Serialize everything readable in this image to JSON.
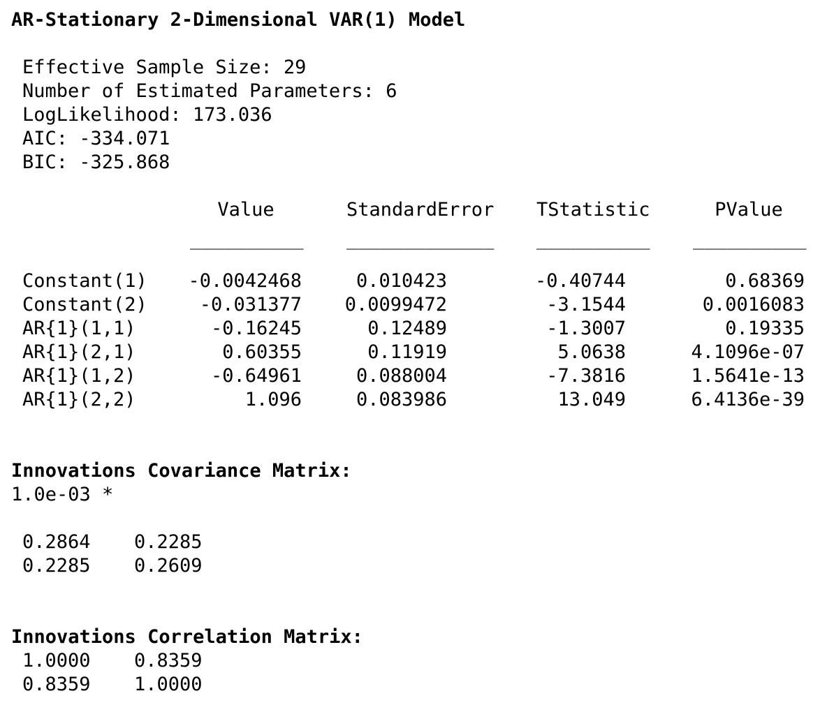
{
  "title": "AR-Stationary 2-Dimensional VAR(1) Model",
  "summary": [
    {
      "label": "Effective Sample Size:",
      "value": "29"
    },
    {
      "label": "Number of Estimated Parameters:",
      "value": "6"
    },
    {
      "label": "LogLikelihood:",
      "value": "173.036"
    },
    {
      "label": "AIC:",
      "value": "-334.071"
    },
    {
      "label": "BIC:",
      "value": "-325.868"
    }
  ],
  "table": {
    "headers": [
      "Value",
      "StandardError",
      "TStatistic",
      "PValue"
    ],
    "underlines": [
      "__________",
      "_____________",
      "__________",
      "__________"
    ],
    "rows": [
      {
        "name": "Constant(1)",
        "value": "-0.0042468",
        "se": "0.010423",
        "t": "-0.40744",
        "p": "0.68369"
      },
      {
        "name": "Constant(2)",
        "value": "-0.031377",
        "se": "0.0099472",
        "t": "-3.1544",
        "p": "0.0016083"
      },
      {
        "name": "AR{1}(1,1)",
        "value": "-0.16245",
        "se": "0.12489",
        "t": "-1.3007",
        "p": "0.19335"
      },
      {
        "name": "AR{1}(2,1)",
        "value": "0.60355",
        "se": "0.11919",
        "t": "5.0638",
        "p": "4.1096e-07"
      },
      {
        "name": "AR{1}(1,2)",
        "value": "-0.64961",
        "se": "0.088004",
        "t": "-7.3816",
        "p": "1.5641e-13"
      },
      {
        "name": "AR{1}(2,2)",
        "value": "1.096",
        "se": "0.083986",
        "t": "13.049",
        "p": "6.4136e-39"
      }
    ]
  },
  "covariance": {
    "heading": "Innovations Covariance Matrix:",
    "scale": "1.0e-03 *",
    "rows": [
      [
        "0.2864",
        "0.2285"
      ],
      [
        "0.2285",
        "0.2609"
      ]
    ]
  },
  "correlation": {
    "heading": "Innovations Correlation Matrix:",
    "rows": [
      [
        "1.0000",
        "0.8359"
      ],
      [
        "0.8359",
        "1.0000"
      ]
    ]
  }
}
